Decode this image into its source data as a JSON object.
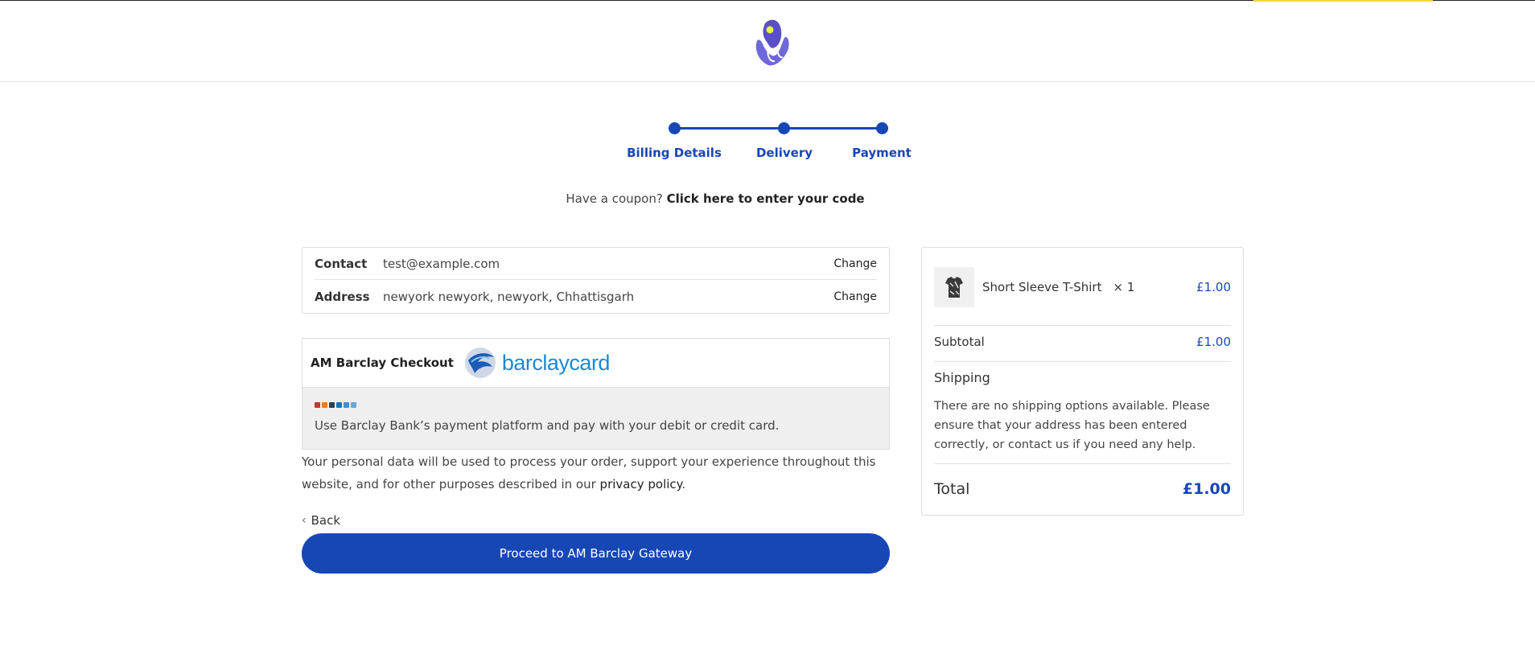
{
  "colors": {
    "accent": "#1747b5",
    "top_accent": "#f5d547",
    "brand_blue": "#1a8ad4"
  },
  "steps": [
    {
      "label": "Billing Details"
    },
    {
      "label": "Delivery"
    },
    {
      "label": "Payment"
    }
  ],
  "coupon": {
    "prompt": "Have a coupon?",
    "link": "Click here to enter your code"
  },
  "info": {
    "contact_label": "Contact",
    "contact_value": "test@example.com",
    "address_label": "Address",
    "address_value": "newyork newyork, newyork, Chhattisgarh",
    "change_label": "Change"
  },
  "payment": {
    "title": "AM Barclay Checkout",
    "brand": "barclaycard",
    "description": "Use Barclay Bank’s payment platform and pay with your debit or credit card."
  },
  "privacy": {
    "text": "Your personal data will be used to process your order, support your experience throughout this website, and for other purposes described in our",
    "link": "privacy policy",
    "end": "."
  },
  "back_label": "Back",
  "proceed_label": "Proceed to AM Barclay Gateway",
  "summary": {
    "item_name": "Short Sleeve T-Shirt",
    "item_qty": "× 1",
    "item_price": "£1.00",
    "subtotal_label": "Subtotal",
    "subtotal_value": "£1.00",
    "shipping_label": "Shipping",
    "shipping_text": "There are no shipping options available. Please ensure that your address has been entered correctly, or contact us if you need any help.",
    "total_label": "Total",
    "total_value": "£1.00"
  }
}
